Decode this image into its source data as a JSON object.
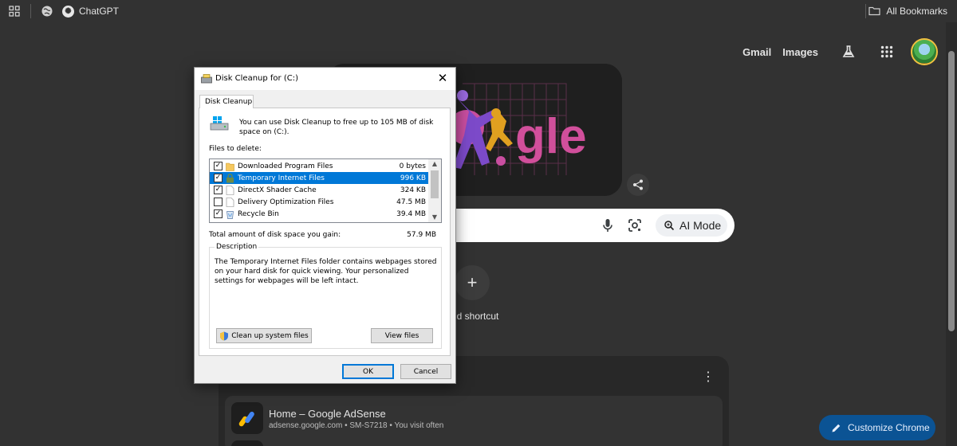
{
  "bookmarks_bar": {
    "chatgpt_label": "ChatGPT",
    "all_bookmarks_label": "All Bookmarks"
  },
  "google_header": {
    "gmail_label": "Gmail",
    "images_label": "Images"
  },
  "doodle": {
    "text": "gle"
  },
  "search": {
    "ai_mode_label": "AI Mode"
  },
  "shortcut": {
    "add_label": "dd shortcut",
    "plus": "+"
  },
  "cards": {
    "menu_glyph": "⋮",
    "item": {
      "title": "Home – Google AdSense",
      "subtitle": "adsense.google.com • SM-S7218 • You visit often"
    }
  },
  "customize": {
    "label": "Customize Chrome"
  },
  "dialog": {
    "title": "Disk Cleanup for  (C:)",
    "close_glyph": "✕",
    "tab_label": "Disk Cleanup",
    "intro_text": "You can use Disk Cleanup to free up to 105 MB of disk space on  (C:).",
    "files_label": "Files to delete:",
    "files": [
      {
        "name": "Downloaded Program Files",
        "size": "0 bytes",
        "checked": true,
        "check_glyph": "✓"
      },
      {
        "name": "Temporary Internet Files",
        "size": "996 KB",
        "checked": true,
        "check_glyph": "✓"
      },
      {
        "name": "DirectX Shader Cache",
        "size": "324 KB",
        "checked": true,
        "check_glyph": "✓"
      },
      {
        "name": "Delivery Optimization Files",
        "size": "47.5 MB",
        "checked": false,
        "check_glyph": ""
      },
      {
        "name": "Recycle Bin",
        "size": "39.4 MB",
        "checked": true,
        "check_glyph": "✓"
      }
    ],
    "selected_index": 1,
    "total_label": "Total amount of disk space you gain:",
    "total_value": "57.9 MB",
    "description_legend": "Description",
    "description_text": "The Temporary Internet Files folder contains webpages stored on your hard disk for quick viewing. Your personalized settings for webpages will be left intact.",
    "cleanup_button": "Clean up system files",
    "view_files_button": "View files",
    "ok_button": "OK",
    "cancel_button": "Cancel"
  },
  "colors": {
    "page_bg": "#323232",
    "selection_blue": "#0078d7",
    "customize_bg": "#0b5394"
  }
}
